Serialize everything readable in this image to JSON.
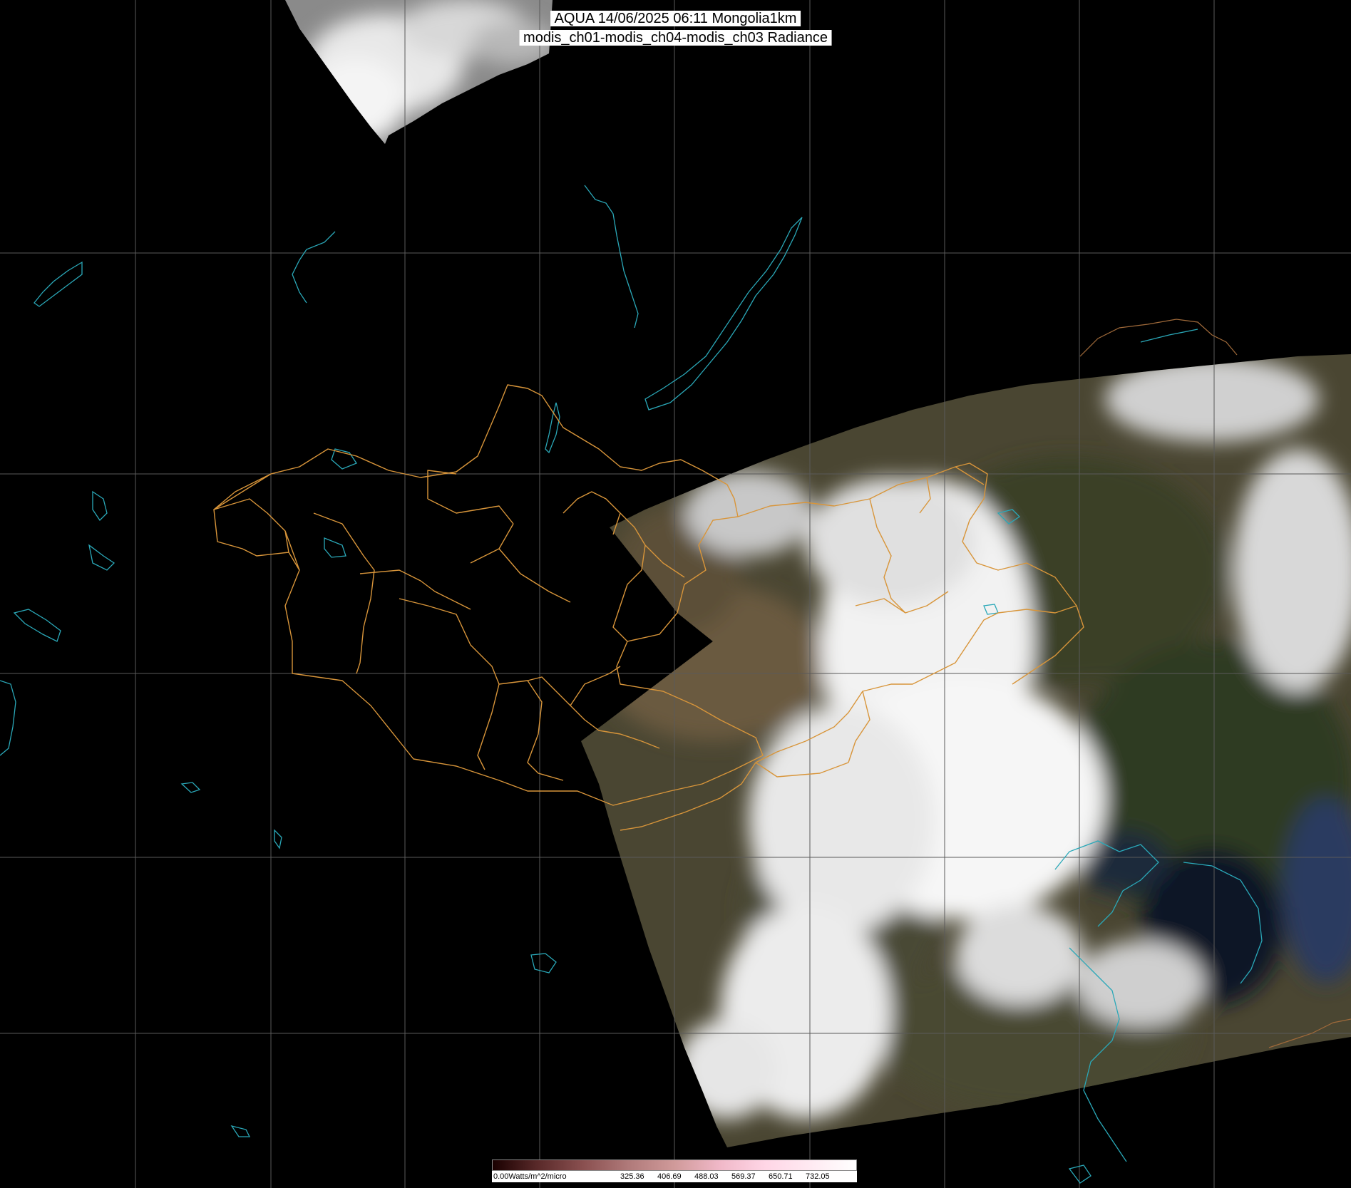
{
  "header": {
    "title_line1": "AQUA 14/06/2025 06:11 Mongolia1km",
    "title_line2": "modis_ch01-modis_ch04-modis_ch03 Radiance"
  },
  "colorbar": {
    "unit_label": "0.00Watts/m^2/micro",
    "ticks": [
      "325.36",
      "406.69",
      "488.03",
      "569.37",
      "650.71",
      "732.05"
    ],
    "colors": [
      "#1a0000",
      "#5a2a2a",
      "#8a5050",
      "#b07a7a",
      "#d09a9a",
      "#f0b8c8",
      "#ffd6e6",
      "#ffeaf2",
      "#ffffff"
    ]
  },
  "colors": {
    "background": "#000000",
    "grid": "#5a5a5a",
    "border": "#d8953a",
    "water": "#2aa8b8",
    "cloud": "#f2f2f2",
    "land_dark": "#3a3a2a",
    "land_brown": "#6a5a3a",
    "land_green": "#34402a",
    "sea": "#0a1030"
  }
}
